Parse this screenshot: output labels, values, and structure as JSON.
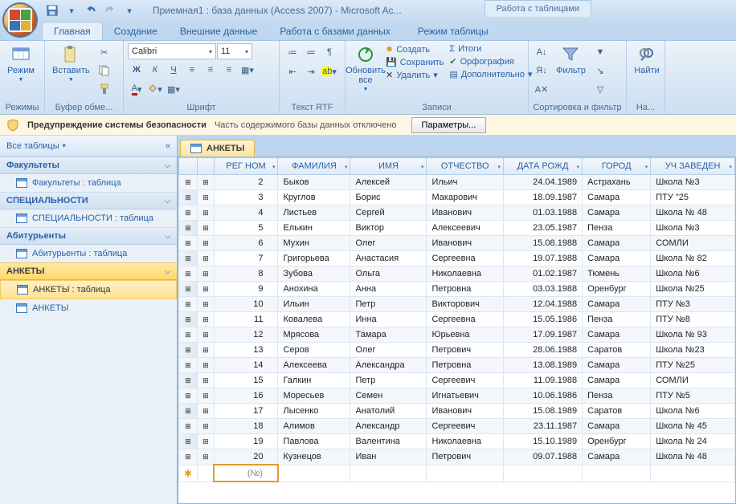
{
  "title": "Приемная1 : база данных (Access 2007) - Microsoft Ac...",
  "context_tab_group": "Работа с таблицами",
  "tabs": [
    "Главная",
    "Создание",
    "Внешние данные",
    "Работа с базами данных",
    "Режим таблицы"
  ],
  "ribbon": {
    "groups": {
      "views": {
        "label": "Режимы",
        "btn": "Режим"
      },
      "clipboard": {
        "label": "Буфер обме...",
        "btn": "Вставить"
      },
      "font": {
        "label": "Шрифт",
        "name": "Calibri",
        "size": "11"
      },
      "richtext": {
        "label": "Текст RTF"
      },
      "records": {
        "label": "Записи",
        "refresh": "Обновить все",
        "new": "Создать",
        "save": "Сохранить",
        "delete": "Удалить",
        "totals": "Итоги",
        "spelling": "Орфография",
        "more": "Дополнительно"
      },
      "sortfilter": {
        "label": "Сортировка и фильтр",
        "filter": "Фильтр"
      },
      "find": {
        "label": "На...",
        "btn": "Найти"
      }
    }
  },
  "security": {
    "warn": "Предупреждение системы безопасности",
    "msg": "Часть содержимого базы данных отключено",
    "button": "Параметры..."
  },
  "nav": {
    "header": "Все таблицы",
    "groups": [
      {
        "name": "Факультеты",
        "items": [
          "Факультеты : таблица"
        ]
      },
      {
        "name": "СПЕЦИАЛЬНОСТИ",
        "items": [
          "СПЕЦИАЛЬНОСТИ : таблица"
        ]
      },
      {
        "name": "Абитурьенты",
        "items": [
          "Абитурьенты : таблица"
        ]
      },
      {
        "name": "АНКЕТЫ",
        "items": [
          "АНКЕТЫ : таблица",
          "АНКЕТЫ"
        ],
        "selected": true
      }
    ]
  },
  "doc": {
    "tab": "АНКЕТЫ",
    "columns": [
      "РЕГ НОМ",
      "ФАМИЛИЯ",
      "ИМЯ",
      "ОТЧЕСТВО",
      "ДАТА РОЖД",
      "ГОРОД",
      "УЧ ЗАВЕДЕН"
    ],
    "rows": [
      [
        "2",
        "Быков",
        "Алексей",
        "Ильич",
        "24.04.1989",
        "Астрахань",
        "Школа №3"
      ],
      [
        "3",
        "Круглов",
        "Борис",
        "Макарович",
        "18.09.1987",
        "Самара",
        "ПТУ \"25"
      ],
      [
        "4",
        "Листьев",
        "Сергей",
        "Иванович",
        "01.03.1988",
        "Самара",
        "Школа № 48"
      ],
      [
        "5",
        "Елькин",
        "Виктор",
        "Алексеевич",
        "23.05.1987",
        "Пенза",
        "Школа №3"
      ],
      [
        "6",
        "Мухин",
        "Олег",
        "Иванович",
        "15.08.1988",
        "Самара",
        "СОМЛИ"
      ],
      [
        "7",
        "Григорьева",
        "Анастасия",
        "Сергеевна",
        "19.07.1988",
        "Самара",
        "Школа № 82"
      ],
      [
        "8",
        "Зубова",
        "Ольга",
        "Николаевна",
        "01.02.1987",
        "Тюмень",
        "Школа №6"
      ],
      [
        "9",
        "Анохина",
        "Анна",
        "Петровна",
        "03.03.1988",
        "Оренбург",
        "Школа №25"
      ],
      [
        "10",
        "Ильин",
        "Петр",
        "Викторович",
        "12.04.1988",
        "Самара",
        "ПТУ №3"
      ],
      [
        "11",
        "Ковалева",
        "Инна",
        "Сергеевна",
        "15.05.1986",
        "Пенза",
        "ПТУ №8"
      ],
      [
        "12",
        "Мрясова",
        "Тамара",
        "Юрьевна",
        "17.09.1987",
        "Самара",
        "Школа № 93"
      ],
      [
        "13",
        "Серов",
        "Олег",
        "Петрович",
        "28.06.1988",
        "Саратов",
        "Школа №23"
      ],
      [
        "14",
        "Алексеева",
        "Александра",
        "Петровна",
        "13.08.1989",
        "Самара",
        "ПТУ №25"
      ],
      [
        "15",
        "Галкин",
        "Петр",
        "Сергеевич",
        "11.09.1988",
        "Самара",
        "СОМЛИ"
      ],
      [
        "16",
        "Моресьев",
        "Семен",
        "Игнатьевич",
        "10.06.1986",
        "Пенза",
        "ПТУ №5"
      ],
      [
        "17",
        "Лысенко",
        "Анатолий",
        "Иванович",
        "15.08.1989",
        "Саратов",
        "Школа №6"
      ],
      [
        "18",
        "Алимов",
        "Александр",
        "Сергеевич",
        "23.11.1987",
        "Самара",
        "Школа № 45"
      ],
      [
        "19",
        "Павлова",
        "Валентина",
        "Николаевна",
        "15.10.1989",
        "Оренбург",
        "Школа № 24"
      ],
      [
        "20",
        "Кузнецов",
        "Иван",
        "Петрович",
        "09.07.1988",
        "Самара",
        "Школа № 48"
      ]
    ],
    "newrow_placeholder": "№"
  }
}
